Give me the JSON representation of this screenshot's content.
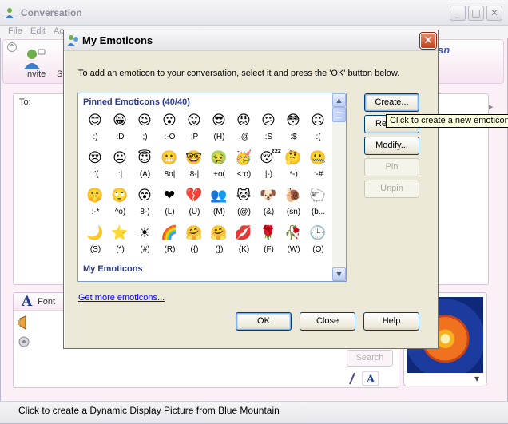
{
  "background_window": {
    "title": "Conversation",
    "menu": [
      "File",
      "Edit",
      "Ac"
    ],
    "toolbar": {
      "invite_label": "Invite",
      "next_label_fragment": "S"
    },
    "brand": "sn",
    "to_label": "To:",
    "font_label": "Font",
    "search_label": "Search",
    "status_text": "Click to create a Dynamic Display Picture from Blue Mountain"
  },
  "dialog": {
    "title": "My Emoticons",
    "close_glyph": "✕",
    "instructions": "To add an emoticon to your conversation, select it and press the 'OK' button below.",
    "pinned_header": "Pinned Emoticons (40/40)",
    "my_header": "My Emoticons",
    "emoticons": [
      {
        "glyph": "😊",
        "shortcut": ":)"
      },
      {
        "glyph": "😁",
        "shortcut": ":D"
      },
      {
        "glyph": "😉",
        "shortcut": ";)"
      },
      {
        "glyph": "😮",
        "shortcut": ":-O"
      },
      {
        "glyph": "😛",
        "shortcut": ":P"
      },
      {
        "glyph": "😎",
        "shortcut": "(H)"
      },
      {
        "glyph": "😡",
        "shortcut": ":@"
      },
      {
        "glyph": "😕",
        "shortcut": ":S"
      },
      {
        "glyph": "😳",
        "shortcut": ":$"
      },
      {
        "glyph": "☹",
        "shortcut": ":("
      },
      {
        "glyph": "😢",
        "shortcut": ":'("
      },
      {
        "glyph": "😐",
        "shortcut": ":|"
      },
      {
        "glyph": "😇",
        "shortcut": "(A)"
      },
      {
        "glyph": "😬",
        "shortcut": "8o|"
      },
      {
        "glyph": "🤓",
        "shortcut": "8-|"
      },
      {
        "glyph": "🤢",
        "shortcut": "+o("
      },
      {
        "glyph": "🥳",
        "shortcut": "<:o)"
      },
      {
        "glyph": "😴",
        "shortcut": "|-)"
      },
      {
        "glyph": "🤔",
        "shortcut": "*-)"
      },
      {
        "glyph": "🤐",
        "shortcut": ":-#"
      },
      {
        "glyph": "🤫",
        "shortcut": ":-*"
      },
      {
        "glyph": "🙄",
        "shortcut": "^o)"
      },
      {
        "glyph": "😵",
        "shortcut": "8-)"
      },
      {
        "glyph": "❤",
        "shortcut": "(L)"
      },
      {
        "glyph": "💔",
        "shortcut": "(U)"
      },
      {
        "glyph": "👥",
        "shortcut": "(M)"
      },
      {
        "glyph": "🐱",
        "shortcut": "(@)"
      },
      {
        "glyph": "🐶",
        "shortcut": "(&)"
      },
      {
        "glyph": "🐌",
        "shortcut": "(sn)"
      },
      {
        "glyph": "🐑",
        "shortcut": "(b..."
      },
      {
        "glyph": "🌙",
        "shortcut": "(S)"
      },
      {
        "glyph": "⭐",
        "shortcut": "(*)"
      },
      {
        "glyph": "☀",
        "shortcut": "(#)"
      },
      {
        "glyph": "🌈",
        "shortcut": "(R)"
      },
      {
        "glyph": "🤗",
        "shortcut": "({)"
      },
      {
        "glyph": "🤗",
        "shortcut": "(})"
      },
      {
        "glyph": "💋",
        "shortcut": "(K)"
      },
      {
        "glyph": "🌹",
        "shortcut": "(F)"
      },
      {
        "glyph": "🥀",
        "shortcut": "(W)"
      },
      {
        "glyph": "🕒",
        "shortcut": "(O)"
      }
    ],
    "buttons": {
      "create": "Create...",
      "rename": "Re",
      "modify": "Modify...",
      "pin": "Pin",
      "unpin": "Unpin",
      "ok": "OK",
      "close": "Close",
      "help": "Help"
    },
    "link": "Get more emoticons...",
    "tooltip": "Click to create a new emoticon"
  },
  "colors": {
    "accent": "#2d3b8e",
    "close_red": "#c3401a",
    "link": "#0000ff"
  }
}
